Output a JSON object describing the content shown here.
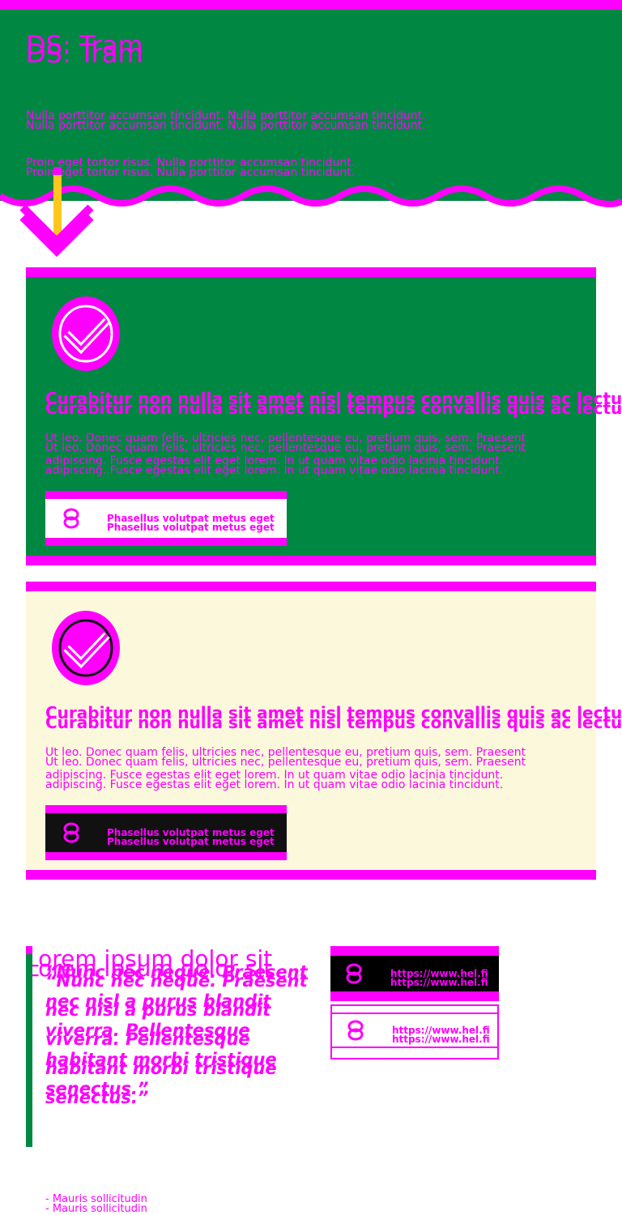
{
  "hero": {
    "title": "DS: Tram",
    "paragraph1": "Nulla porttitor accumsan tincidunt. Nulla porttitor accumsan tincidunt.",
    "paragraph2": "Proin eget tortor risus. Nulla porttitor accumsan tincidunt."
  },
  "cards": [
    {
      "icon": "check-circle-icon",
      "heading": "Curabitur non nulla sit amet nisl tempus convallis quis ac lectus",
      "body_line1": "Ut leo. Donec quam felis, ultricies nec, pellentesque eu, pretium quis, sem. Praesent",
      "body_line2": "adipiscing. Fusce egestas elit eget lorem. In ut quam vitae odio lacinia tincidunt.",
      "button_label": "Phasellus volutpat metus eget",
      "button_icon": "link-icon"
    },
    {
      "icon": "check-circle-icon",
      "heading": "Curabitur non nulla sit amet nisl tempus convallis quis ac lectus",
      "body_line1": "Ut leo. Donec quam felis, ultricies nec, pellentesque eu, pretium quis, sem. Praesent",
      "body_line2": "adipiscing. Fusce egestas elit eget lorem. In ut quam vitae odio lacinia tincidunt.",
      "button_label": "Phasellus volutpat metus eget",
      "button_icon": "link-icon"
    }
  ],
  "section": {
    "title": "Lorem ipsum dolor sit",
    "quote_lines": [
      "“Nunc nec neque. Praesent",
      "nec nisl a purus blandit",
      "viverra. Pellentesque",
      "habitant morbi tristique",
      "senectus.”"
    ],
    "quote_author": "- Mauris sollicitudin",
    "links": [
      {
        "label": "https://www.hel.fi",
        "icon": "link-icon"
      },
      {
        "label": "https://www.hel.fi",
        "icon": "link-icon"
      }
    ]
  },
  "colors": {
    "accent": "#ff00ff",
    "tram_green": "#008741",
    "cream": "#fbf8dc",
    "arrow_yellow": "#ffc61e"
  }
}
